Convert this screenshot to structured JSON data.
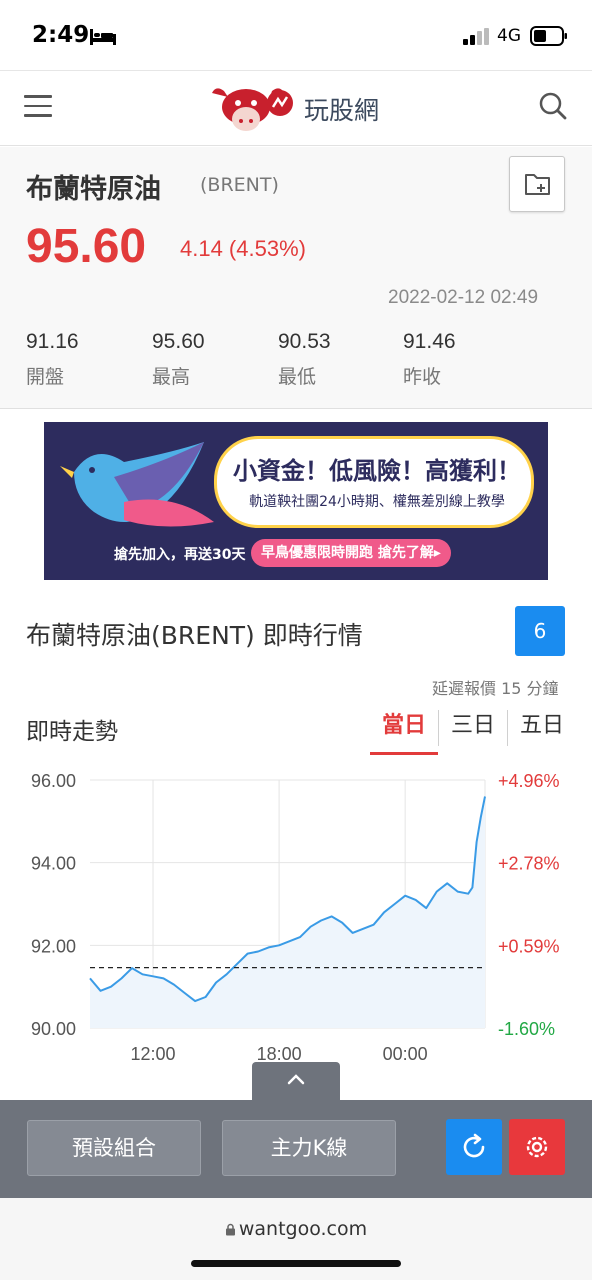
{
  "status": {
    "time": "2:49",
    "network": "4G"
  },
  "header": {
    "site_name": "玩股網"
  },
  "quote": {
    "name": "布蘭特原油",
    "code": "(BRENT)",
    "price": "95.60",
    "change": "4.14 (4.53%)",
    "timestamp": "2022-02-12 02:49",
    "stats": [
      {
        "value": "91.16",
        "label": "開盤"
      },
      {
        "value": "95.60",
        "label": "最高"
      },
      {
        "value": "90.53",
        "label": "最低"
      },
      {
        "value": "91.46",
        "label": "昨收"
      }
    ]
  },
  "ad": {
    "headline": "小資金！低風險！高獲利！",
    "subline": "軌道鞅社團24小時期、權無差別線上教學",
    "bottom_left": "搶先加入，再送30天",
    "cta": "早鳥優惠限時開跑 搶先了解▸"
  },
  "realtime": {
    "title": "布蘭特原油(BRENT) 即時行情",
    "count": "6",
    "delay_note": "延遲報價 15 分鐘",
    "trend_title": "即時走勢",
    "tabs": [
      "當日",
      "三日",
      "五日"
    ],
    "active_tab": 0
  },
  "chart_data": {
    "type": "area",
    "y_ticks": [
      "96.00",
      "94.00",
      "92.00",
      "90.00"
    ],
    "pct_ticks": [
      "+4.96%",
      "+2.78%",
      "+0.59%",
      "-1.60%"
    ],
    "x_ticks": [
      "12:00",
      "18:00",
      "00:00"
    ],
    "ylim": [
      90.0,
      96.0
    ],
    "reference_line": 91.46,
    "x_hours": [
      9.0,
      9.5,
      10.0,
      10.5,
      11.0,
      11.5,
      12.0,
      12.5,
      13.0,
      13.5,
      14.0,
      14.5,
      15.0,
      15.5,
      16.0,
      16.5,
      17.0,
      17.5,
      18.0,
      18.5,
      19.0,
      19.5,
      20.0,
      20.5,
      21.0,
      21.5,
      22.0,
      22.5,
      23.0,
      23.5,
      24.0,
      24.5,
      25.0,
      25.5,
      26.0,
      26.5,
      27.0,
      27.2,
      27.4,
      27.6,
      27.8
    ],
    "values": [
      91.2,
      90.9,
      91.0,
      91.2,
      91.45,
      91.3,
      91.25,
      91.2,
      91.05,
      90.85,
      90.65,
      90.75,
      91.1,
      91.3,
      91.55,
      91.8,
      91.85,
      91.95,
      92.0,
      92.1,
      92.2,
      92.45,
      92.6,
      92.7,
      92.55,
      92.3,
      92.4,
      92.5,
      92.8,
      93.0,
      93.2,
      93.1,
      92.9,
      93.3,
      93.5,
      93.3,
      93.25,
      93.4,
      94.5,
      95.1,
      95.6
    ],
    "colors": {
      "line": "#3a9be6",
      "fill": "#eef5fc",
      "up": "#e23b3b",
      "down": "#22a845"
    }
  },
  "toolbar": {
    "preset_label": "預設組合",
    "kline_label": "主力K線"
  },
  "url": "wantgoo.com"
}
